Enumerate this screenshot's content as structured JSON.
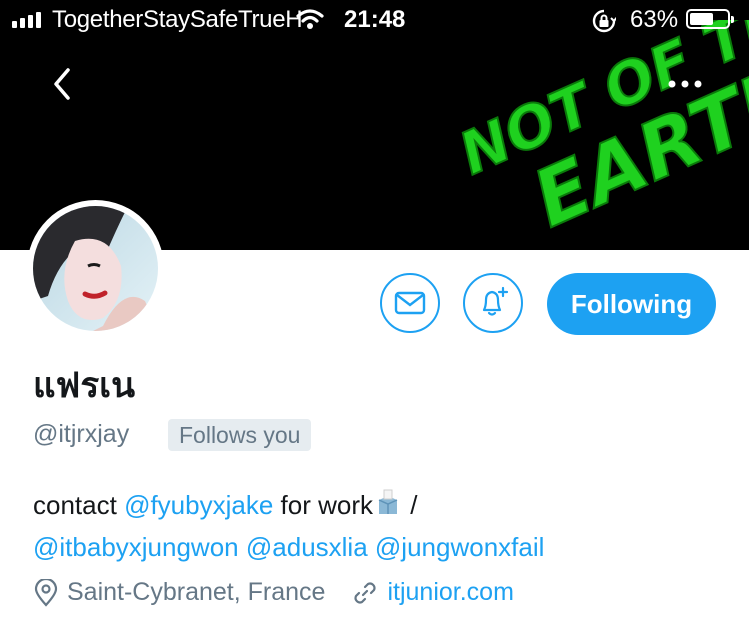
{
  "status_bar": {
    "carrier": "TogetherStaySafeTrueH",
    "time": "21:48",
    "battery_percent": "63%",
    "battery_level": 0.63
  },
  "profile": {
    "display_name": "แฟรเน",
    "handle": "@itjrxjay",
    "follows_you_label": "Follows you",
    "following_button_label": "Following",
    "bio": {
      "line1_prefix": "contact ",
      "line1_mention": "@fyubyxjake",
      "line1_mid": " for work",
      "line1_suffix": " /",
      "line2_mentions": [
        "@itbabyxjungwon",
        "@adusxlia",
        "@jungwonxfail"
      ]
    },
    "location": "Saint-Cybranet, France",
    "website": "itjunior.com"
  },
  "banner_text": {
    "line1": "NOT OF THIS",
    "line2": "EARTH"
  },
  "colors": {
    "accent": "#1da1f2",
    "secondary_text": "#657786",
    "primary_text": "#14171a",
    "banner_green": "#1fd11f"
  },
  "icons": {
    "back": "chevron-left-icon",
    "more": "more-horizontal-icon",
    "message": "envelope-icon",
    "notifications": "bell-plus-icon",
    "location": "map-pin-icon",
    "website": "link-icon"
  }
}
